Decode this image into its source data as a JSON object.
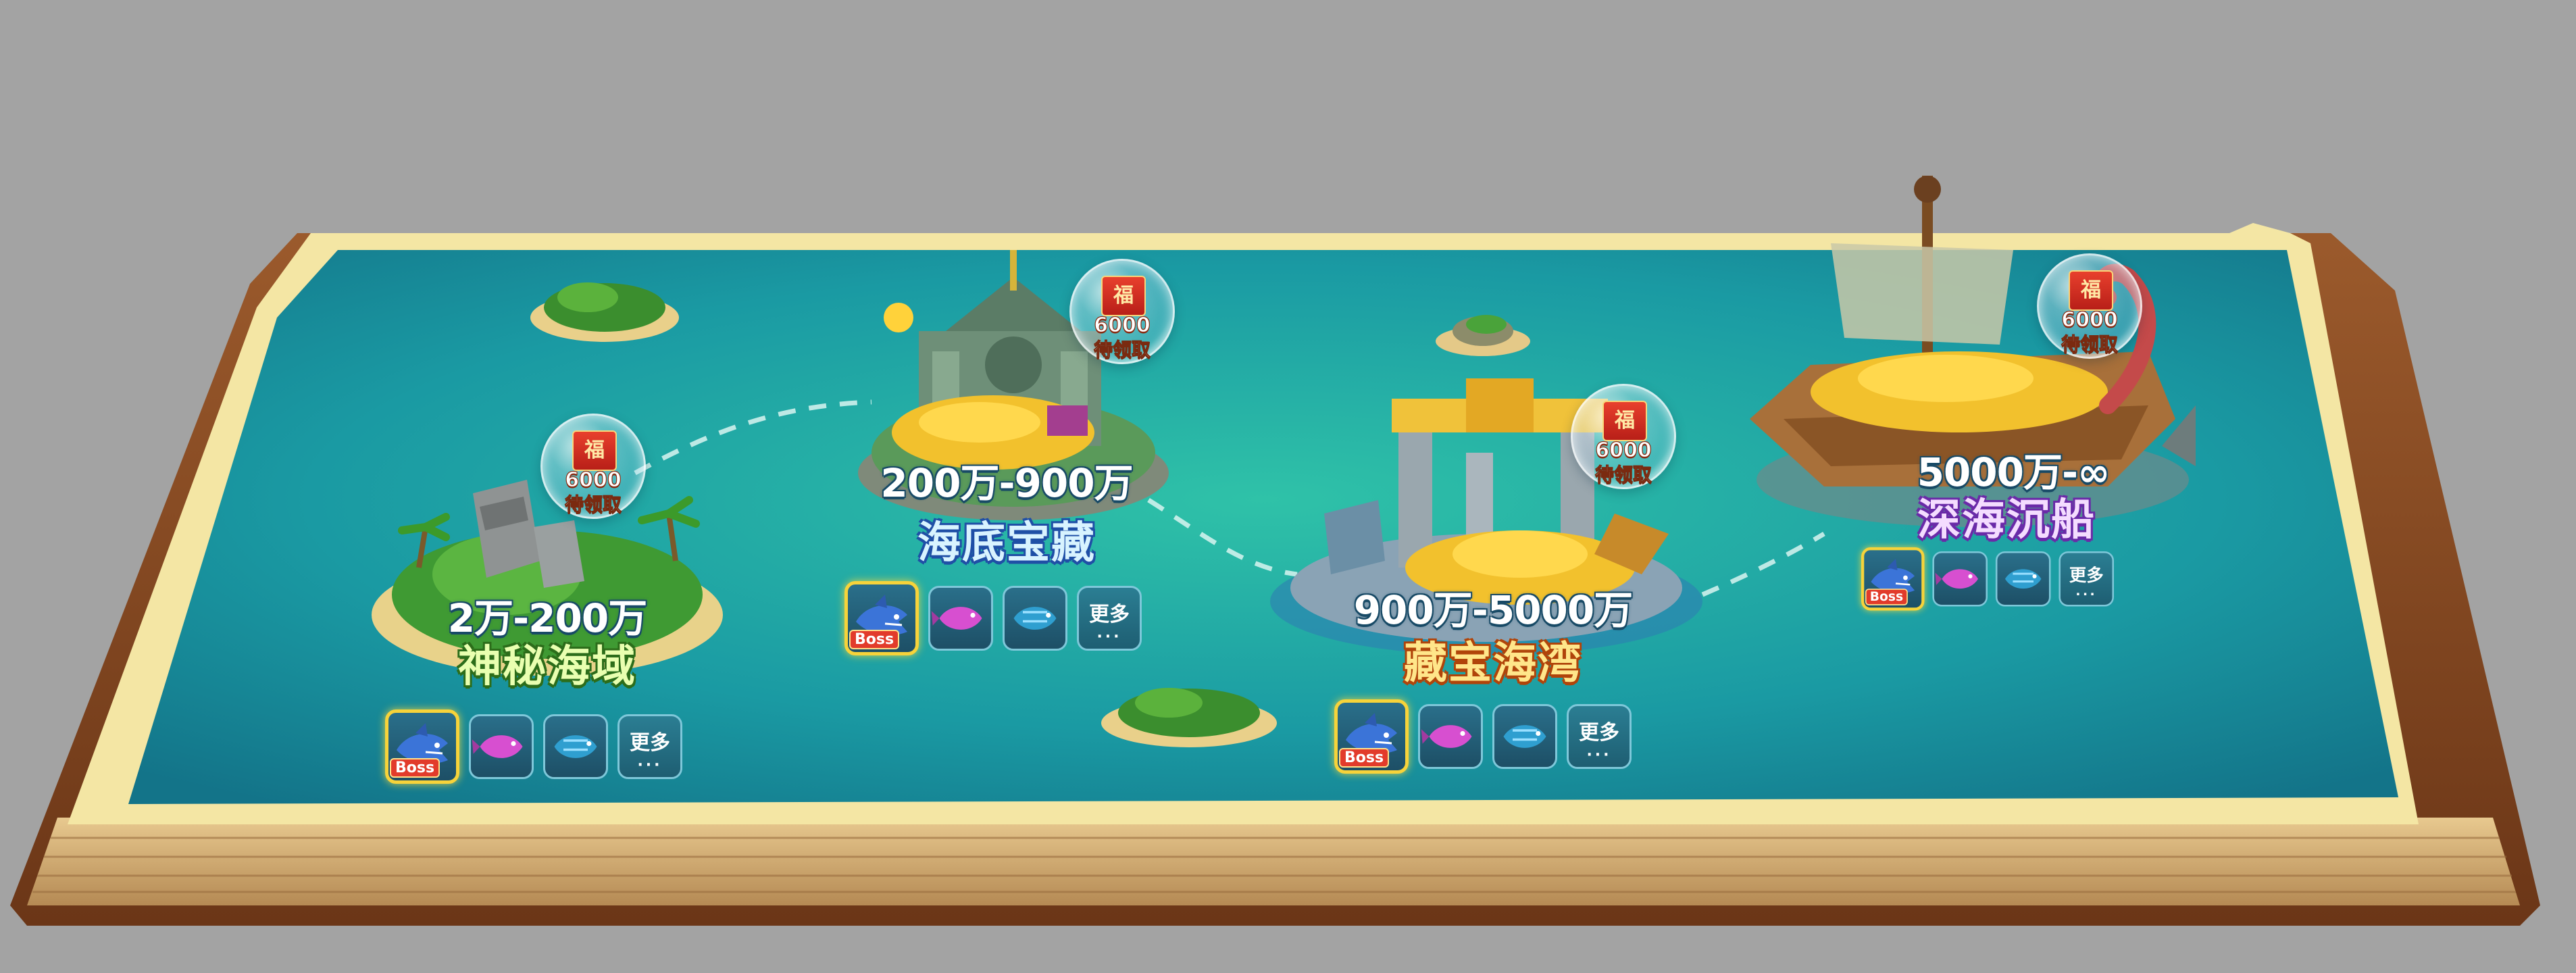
{
  "zones": [
    {
      "range": "2万-200万",
      "name": "神秘海域",
      "reward": {
        "icon": "福",
        "amount": "6000",
        "status": "待领取"
      },
      "boss_label": "Boss",
      "more_label": "更多",
      "more_dots": "···"
    },
    {
      "range": "200万-900万",
      "name": "海底宝藏",
      "reward": {
        "icon": "福",
        "amount": "6000",
        "status": "待领取"
      },
      "boss_label": "Boss",
      "more_label": "更多",
      "more_dots": "···"
    },
    {
      "range": "900万-5000万",
      "name": "藏宝海湾",
      "reward": {
        "icon": "福",
        "amount": "6000",
        "status": "待领取"
      },
      "boss_label": "Boss",
      "more_label": "更多",
      "more_dots": "···"
    },
    {
      "range": "5000万-∞",
      "name": "深海沉船",
      "reward": {
        "icon": "福",
        "amount": "6000",
        "status": "待领取"
      },
      "boss_label": "Boss",
      "more_label": "更多",
      "more_dots": "···"
    }
  ],
  "colors": {
    "background": "#a3a3a3",
    "sea": "#1fa0a6",
    "page_border": "#f4e6a4",
    "book_cover": "#8a4b24"
  },
  "icons": [
    "red-envelope-icon",
    "shark-boss-icon",
    "pink-fish-icon",
    "blue-fish-icon"
  ]
}
